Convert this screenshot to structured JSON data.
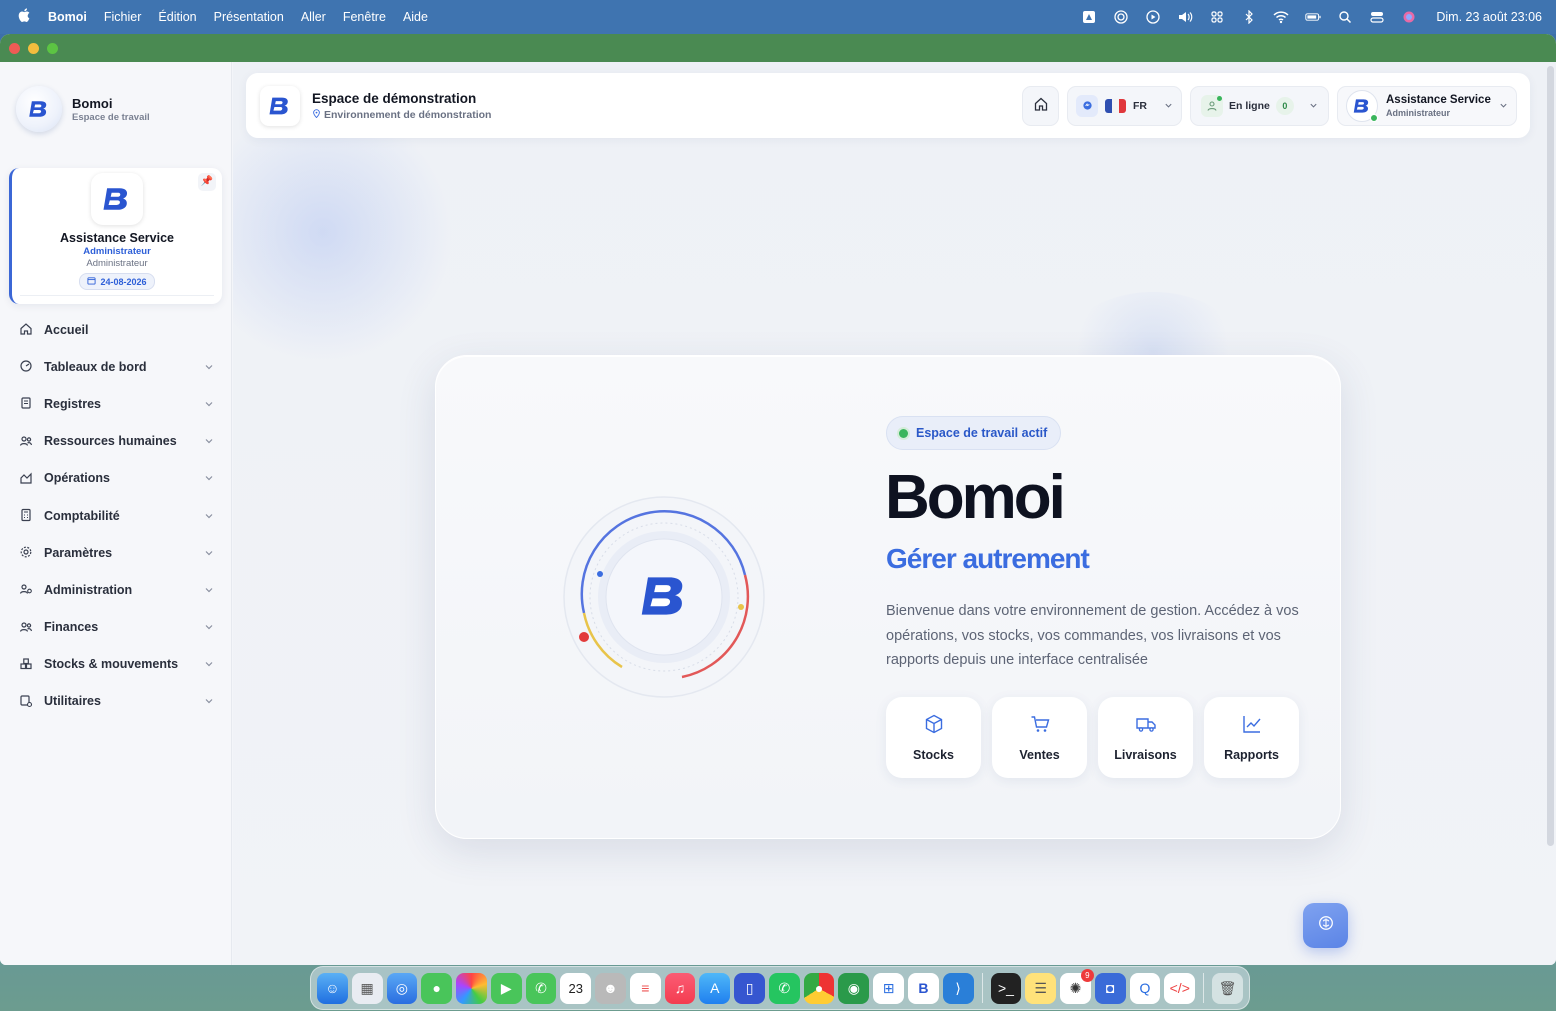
{
  "menubar": {
    "app": "Bomoi",
    "items": [
      "Fichier",
      "Édition",
      "Présentation",
      "Aller",
      "Fenêtre",
      "Aide"
    ],
    "clock": "Dim. 23 août  23:06"
  },
  "sidebar": {
    "brand_name": "Bomoi",
    "brand_sub": "Espace de travail",
    "user": {
      "name": "Assistance Service",
      "role": "Administrateur",
      "role2": "Administrateur",
      "date": "24-08-2026"
    },
    "nav": [
      {
        "label": "Accueil",
        "icon": "home-icon"
      },
      {
        "label": "Tableaux de bord",
        "icon": "dashboard-icon"
      },
      {
        "label": "Registres",
        "icon": "book-icon"
      },
      {
        "label": "Ressources humaines",
        "icon": "people-icon"
      },
      {
        "label": "Opérations",
        "icon": "operations-icon"
      },
      {
        "label": "Comptabilité",
        "icon": "calculator-icon"
      },
      {
        "label": "Paramètres",
        "icon": "gear-icon"
      },
      {
        "label": "Administration",
        "icon": "admin-icon"
      },
      {
        "label": "Finances",
        "icon": "finance-icon"
      },
      {
        "label": "Stocks & mouvements",
        "icon": "stock-icon"
      },
      {
        "label": "Utilitaires",
        "icon": "tools-icon"
      }
    ]
  },
  "topbar": {
    "title": "Espace de démonstration",
    "subtitle": "Environnement de démonstration",
    "lang": "FR",
    "online_label": "En ligne",
    "online_count": "0",
    "user_name": "Assistance Service",
    "user_role": "Administrateur"
  },
  "hero": {
    "pill": "Espace de travail actif",
    "title": "Bomoi",
    "tagline": "Gérer autrement",
    "description": "Bienvenue dans votre environnement de gestion. Accédez à vos opérations, vos stocks, vos commandes, vos livraisons et vos rapports depuis une interface centralisée",
    "tiles": [
      {
        "label": "Stocks",
        "icon": "box-icon"
      },
      {
        "label": "Ventes",
        "icon": "cart-icon"
      },
      {
        "label": "Livraisons",
        "icon": "truck-icon"
      },
      {
        "label": "Rapports",
        "icon": "chart-icon"
      }
    ]
  },
  "dock": {
    "calendar_day": "23",
    "mail_badge": "9"
  },
  "colors": {
    "accent": "#3b6de0",
    "online": "#3ab55c",
    "titlebar": "#4a8a52"
  }
}
